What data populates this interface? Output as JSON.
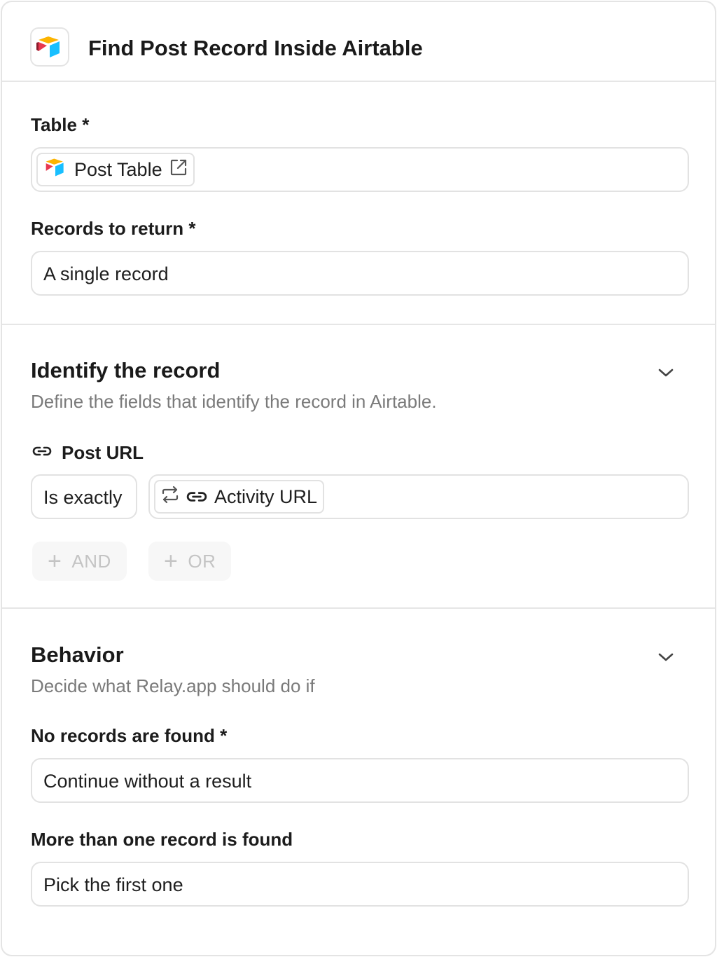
{
  "header": {
    "title": "Find Post Record Inside Airtable",
    "logo_icon": "airtable-logo"
  },
  "table": {
    "label": "Table *",
    "value": "Post Table",
    "value_icon": "airtable-logo",
    "open_icon": "external-link-icon"
  },
  "records": {
    "label": "Records to return *",
    "value": "A single record"
  },
  "identify": {
    "title": "Identify the record",
    "subtitle": "Define the fields that identify the record in Airtable.",
    "field_label": "Post URL",
    "field_icon": "link-icon",
    "operator": "Is exactly",
    "value": "Activity URL",
    "value_icons": [
      "repeat-icon",
      "link-icon"
    ],
    "and_label": "AND",
    "or_label": "OR"
  },
  "behavior": {
    "title": "Behavior",
    "subtitle": "Decide what Relay.app should do if",
    "no_records_label": "No records are found *",
    "no_records_value": "Continue without a result",
    "multiple_label": "More than one record is found",
    "multiple_value": "Pick the first one"
  },
  "colors": {
    "airtable_yellow": "#FCB400",
    "airtable_red": "#E8384F",
    "airtable_blue": "#18BFFF",
    "border": "#E2E2E2",
    "muted_text": "#7A7A7A",
    "disabled_text": "#C4C4C4"
  }
}
